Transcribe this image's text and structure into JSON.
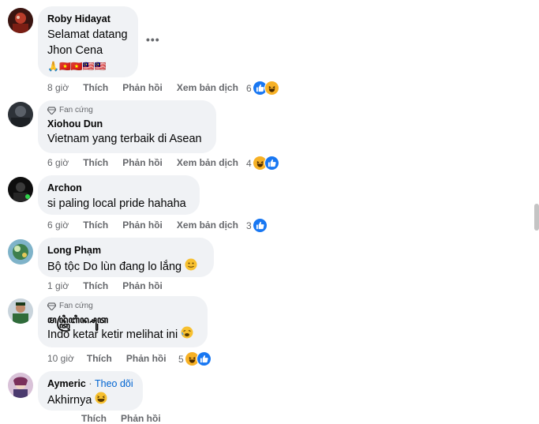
{
  "comments": [
    {
      "name": "Roby Hidayat",
      "lines": [
        "Selamat datang",
        "Jhon Cena"
      ],
      "flags": "🙏🇻🇳🇻🇳🇲🇾🇲🇾",
      "time": "8 giờ",
      "like": "Thích",
      "reply": "Phản hồi",
      "translate": "Xem bản dịch",
      "reaction_count": "6"
    },
    {
      "badge": "Fan cứng",
      "name": "Xiohou Dun",
      "lines": [
        "Vietnam yang terbaik di Asean"
      ],
      "time": "6 giờ",
      "like": "Thích",
      "reply": "Phản hồi",
      "translate": "Xem bản dịch",
      "reaction_count": "4"
    },
    {
      "name": "Archon",
      "lines": [
        "si paling local pride hahaha"
      ],
      "time": "6 giờ",
      "like": "Thích",
      "reply": "Phản hồi",
      "translate": "Xem bản dịch",
      "reaction_count": "3"
    },
    {
      "name": "Long Phạm",
      "lines": [
        "Bộ tộc Do lùn đang lo lắng"
      ],
      "time": "1 giờ",
      "like": "Thích",
      "reply": "Phản hồi"
    },
    {
      "badge": "Fan cứng",
      "name": "ꦩꦤ꧀ꦠꦿꦶꦧꦶꦤ꧀ꦱꦸꦠ",
      "lines": [
        "Indo ketar ketir melihat ini"
      ],
      "time": "10 giờ",
      "like": "Thích",
      "reply": "Phản hồi",
      "reaction_count": "5"
    },
    {
      "name": "Aymeric",
      "separator": "·",
      "follow": "Theo dõi",
      "lines": [
        "Akhirnya"
      ],
      "time": "",
      "like": "Thích",
      "reply": "Phản hồi"
    }
  ],
  "colors": {
    "bubble": "#f0f2f5",
    "meta": "#65676b",
    "link": "#0064d1",
    "like": "#1877f2",
    "haha": "#f7b125"
  }
}
